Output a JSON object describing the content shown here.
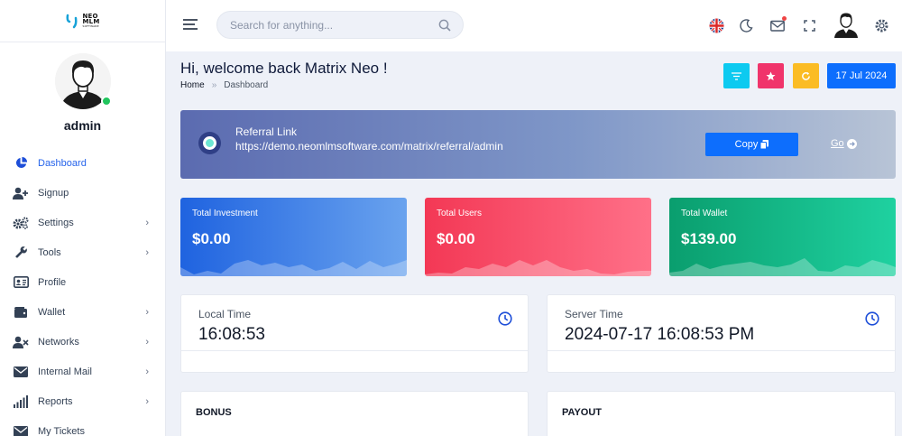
{
  "logo": {
    "line1": "NEO",
    "line2": "MLM",
    "line3": "SOFTWARE"
  },
  "profile": {
    "name": "admin",
    "status_color": "#22c55e"
  },
  "sidebar": {
    "items": [
      {
        "label": "Dashboard",
        "icon": "pie-chart-icon",
        "active": true,
        "has_submenu": false
      },
      {
        "label": "Signup",
        "icon": "user-plus-icon",
        "active": false,
        "has_submenu": false
      },
      {
        "label": "Settings",
        "icon": "gears-icon",
        "active": false,
        "has_submenu": true
      },
      {
        "label": "Tools",
        "icon": "wrench-icon",
        "active": false,
        "has_submenu": true
      },
      {
        "label": "Profile",
        "icon": "id-card-icon",
        "active": false,
        "has_submenu": false
      },
      {
        "label": "Wallet",
        "icon": "wallet-icon",
        "active": false,
        "has_submenu": true
      },
      {
        "label": "Networks",
        "icon": "user-network-icon",
        "active": false,
        "has_submenu": true
      },
      {
        "label": "Internal Mail",
        "icon": "envelope-icon",
        "active": false,
        "has_submenu": true
      },
      {
        "label": "Reports",
        "icon": "bar-signal-icon",
        "active": false,
        "has_submenu": true
      },
      {
        "label": "My Tickets",
        "icon": "envelope-icon",
        "active": false,
        "has_submenu": false
      }
    ],
    "chevron": "›"
  },
  "header": {
    "search_placeholder": "Search for anything...",
    "icons": [
      "uk-flag-icon",
      "moon-icon",
      "mail-icon",
      "fullscreen-icon",
      "user-avatar-icon",
      "settings-gear-icon"
    ]
  },
  "page": {
    "welcome": "Hi, welcome back Matrix Neo !",
    "breadcrumb_home": "Home",
    "breadcrumb_sep": "»",
    "breadcrumb_current": "Dashboard",
    "date": "17 Jul 2024",
    "action_colors": {
      "filter": "#0dcaf0",
      "star": "#f0346b",
      "refresh": "#fbbc24",
      "date": "#0d6efd"
    }
  },
  "referral": {
    "title": "Referral Link",
    "link": "https://demo.neomlmsoftware.com/matrix/referral/admin",
    "copy_label": "Copy",
    "go_label": "Go"
  },
  "stats": [
    {
      "label": "Total Investment",
      "value": "$0.00",
      "color": "#2f6fe6"
    },
    {
      "label": "Total Users",
      "value": "$0.00",
      "color": "#f5425e"
    },
    {
      "label": "Total Wallet",
      "value": "$139.00",
      "color": "#0fae7a"
    }
  ],
  "times": {
    "local_label": "Local Time",
    "local_value": "16:08:53",
    "server_label": "Server Time",
    "server_value": "2024-07-17 16:08:53 PM"
  },
  "sections": {
    "bonus": "BONUS",
    "payout": "PAYOUT"
  }
}
